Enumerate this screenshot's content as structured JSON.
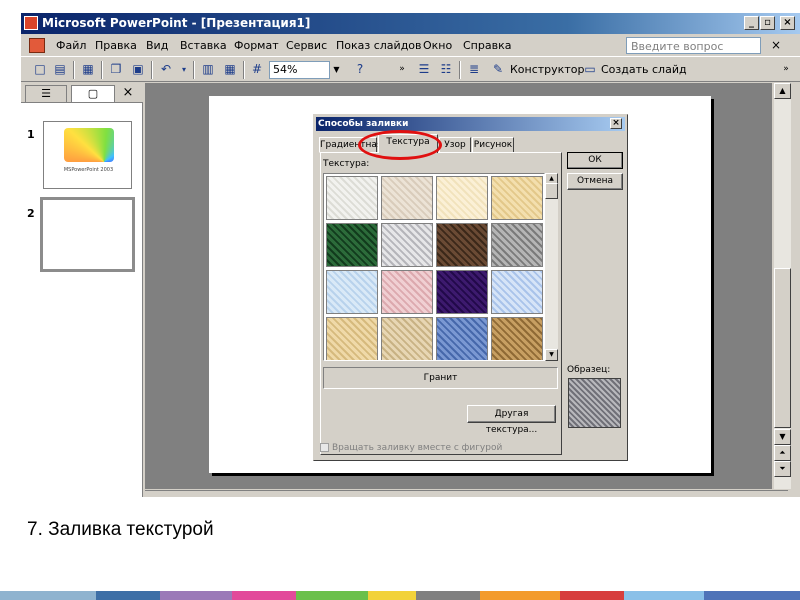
{
  "window": {
    "title": "Microsoft PowerPoint - [Презентация1]",
    "min_glyph": "_",
    "max_glyph": "▫",
    "close_glyph": "×"
  },
  "menu": {
    "items": [
      "Файл",
      "Правка",
      "Вид",
      "Вставка",
      "Формат",
      "Сервис",
      "Показ слайдов",
      "Окно",
      "Справка"
    ],
    "help_placeholder": "Введите вопрос",
    "close_glyph": "×"
  },
  "toolbar": {
    "zoom": "54%",
    "designer_label": "Конструктор",
    "new_slide_label": "Создать слайд"
  },
  "outline_pane": {
    "close_glyph": "×",
    "slides": [
      {
        "number": "1",
        "caption": "MSPowerPoint 2003"
      },
      {
        "number": "2"
      }
    ]
  },
  "dialog": {
    "title": "Способы заливки",
    "close_glyph": "×",
    "tabs": [
      "Градиентная",
      "Текстура",
      "Узор",
      "Рисунок"
    ],
    "selected_tab": "Текстура",
    "texture_label": "Текстура:",
    "selected_texture": "Гранит",
    "other_texture_button": "Другая текстура...",
    "ok_button": "ОК",
    "cancel_button": "Отмена",
    "sample_label": "Образец:",
    "rotate_checkbox": "Вращать заливку вместе с фигурой",
    "rotate_checked": false,
    "textures": [
      {
        "name": "texture-1",
        "colors": [
          "#f2f2ef",
          "#dcdcd6"
        ]
      },
      {
        "name": "texture-2",
        "colors": [
          "#ece3d6",
          "#d9ccbb"
        ]
      },
      {
        "name": "texture-3",
        "colors": [
          "#fbf0d6",
          "#f1e2bc"
        ]
      },
      {
        "name": "texture-4",
        "colors": [
          "#f3dfae",
          "#e3c88a"
        ]
      },
      {
        "name": "texture-5",
        "colors": [
          "#2c6b3a",
          "#123b1d"
        ]
      },
      {
        "name": "texture-6",
        "colors": [
          "#e6e6e8",
          "#b5b5ba"
        ]
      },
      {
        "name": "texture-7",
        "colors": [
          "#6a4a34",
          "#3b2819"
        ]
      },
      {
        "name": "texture-8",
        "colors": [
          "#b5b5b5",
          "#7a7a7a"
        ]
      },
      {
        "name": "texture-9",
        "colors": [
          "#d9e9f7",
          "#b8d2ec"
        ]
      },
      {
        "name": "texture-10",
        "colors": [
          "#f0cfd2",
          "#dca9ae"
        ]
      },
      {
        "name": "texture-11",
        "colors": [
          "#3d1a6e",
          "#22094a"
        ]
      },
      {
        "name": "texture-12",
        "colors": [
          "#d6e4f7",
          "#a9c3ea"
        ]
      },
      {
        "name": "texture-13",
        "colors": [
          "#efd9a8",
          "#d6ba7d"
        ]
      },
      {
        "name": "texture-14",
        "colors": [
          "#e7d6b3",
          "#c8b284"
        ]
      },
      {
        "name": "texture-15",
        "colors": [
          "#7a98d2",
          "#4668ab"
        ]
      },
      {
        "name": "texture-16",
        "colors": [
          "#c79f62",
          "#8f6a35"
        ]
      }
    ],
    "sample_colors": [
      "#b8b8bc",
      "#707078"
    ]
  },
  "caption": "7.   Заливка текстурой",
  "colors": {
    "title_start": "#0a246a",
    "title_end": "#a6caf0",
    "chrome": "#d4d0c8",
    "highlight": "#e01010"
  }
}
